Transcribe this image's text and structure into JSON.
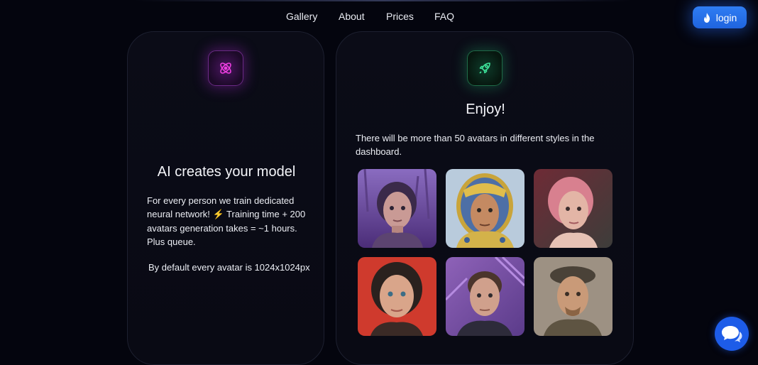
{
  "nav": {
    "links": [
      "Gallery",
      "About",
      "Prices",
      "FAQ"
    ],
    "login_label": "login"
  },
  "left_card": {
    "icon": "atom-icon",
    "title": "AI creates your model",
    "description": "For every person we train dedicated neural network! ⚡ Training time + 200 avatars generation takes = ~1 hours. Plus queue.",
    "note": "By default every avatar is 1024x1024px"
  },
  "right_card": {
    "icon": "rocket-icon",
    "title": "Enjoy!",
    "description": "There will be more than 50 avatars in different styles in the dashboard.",
    "avatars": [
      "avatar-woman-purple-forest",
      "avatar-man-golden-helmet",
      "avatar-woman-pink-hair",
      "avatar-woman-red-background",
      "avatar-man-purple-neon",
      "avatar-man-flat-cap"
    ]
  },
  "chat": {
    "icon": "chat-bubbles-icon"
  },
  "colors": {
    "background": "#04050e",
    "card": "#0b0c17",
    "accent_blue": "#2f7df3",
    "purple_glow": "#b428dc",
    "green_glow": "#28c878"
  }
}
